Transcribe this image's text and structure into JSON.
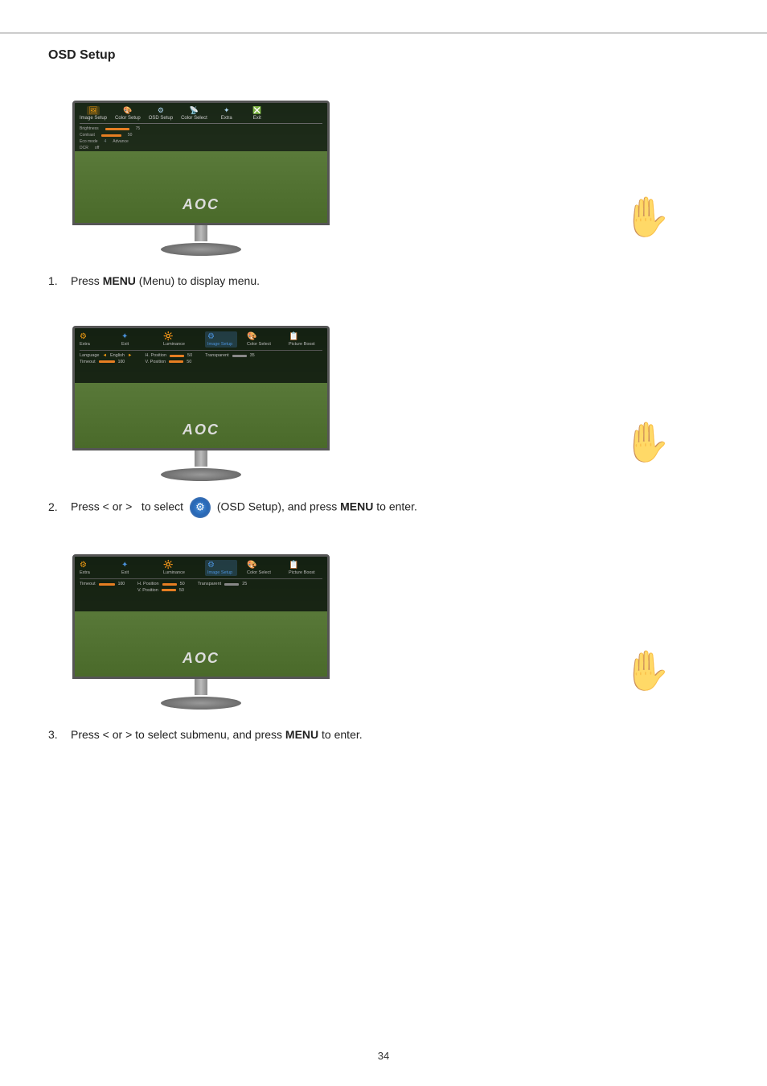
{
  "page": {
    "title": "OSD Setup",
    "page_number": "34",
    "top_border": true
  },
  "steps": [
    {
      "number": "1.",
      "text_before": "Press ",
      "bold_text": "MENU",
      "text_after": " (Menu) to display menu."
    },
    {
      "number": "2.",
      "text_before": "Press < or >  to select ",
      "bold_text": "MENU",
      "text_after": " to enter.",
      "has_icon": true,
      "text_middle": " (OSD Setup), and press "
    },
    {
      "number": "3.",
      "text_before": "Press < or >  to select submenu, and press ",
      "bold_text": "MENU",
      "text_after": " to enter."
    }
  ],
  "monitors": [
    {
      "id": "monitor-1",
      "screen_type": "main-menu"
    },
    {
      "id": "monitor-2",
      "screen_type": "osd-setup-highlighted"
    },
    {
      "id": "monitor-3",
      "screen_type": "osd-setup-submenu"
    }
  ],
  "aoc_logo": "AOC",
  "hand_symbol": "🤚",
  "icons": {
    "gear": "⚙",
    "monitor_icon": "🖥"
  }
}
